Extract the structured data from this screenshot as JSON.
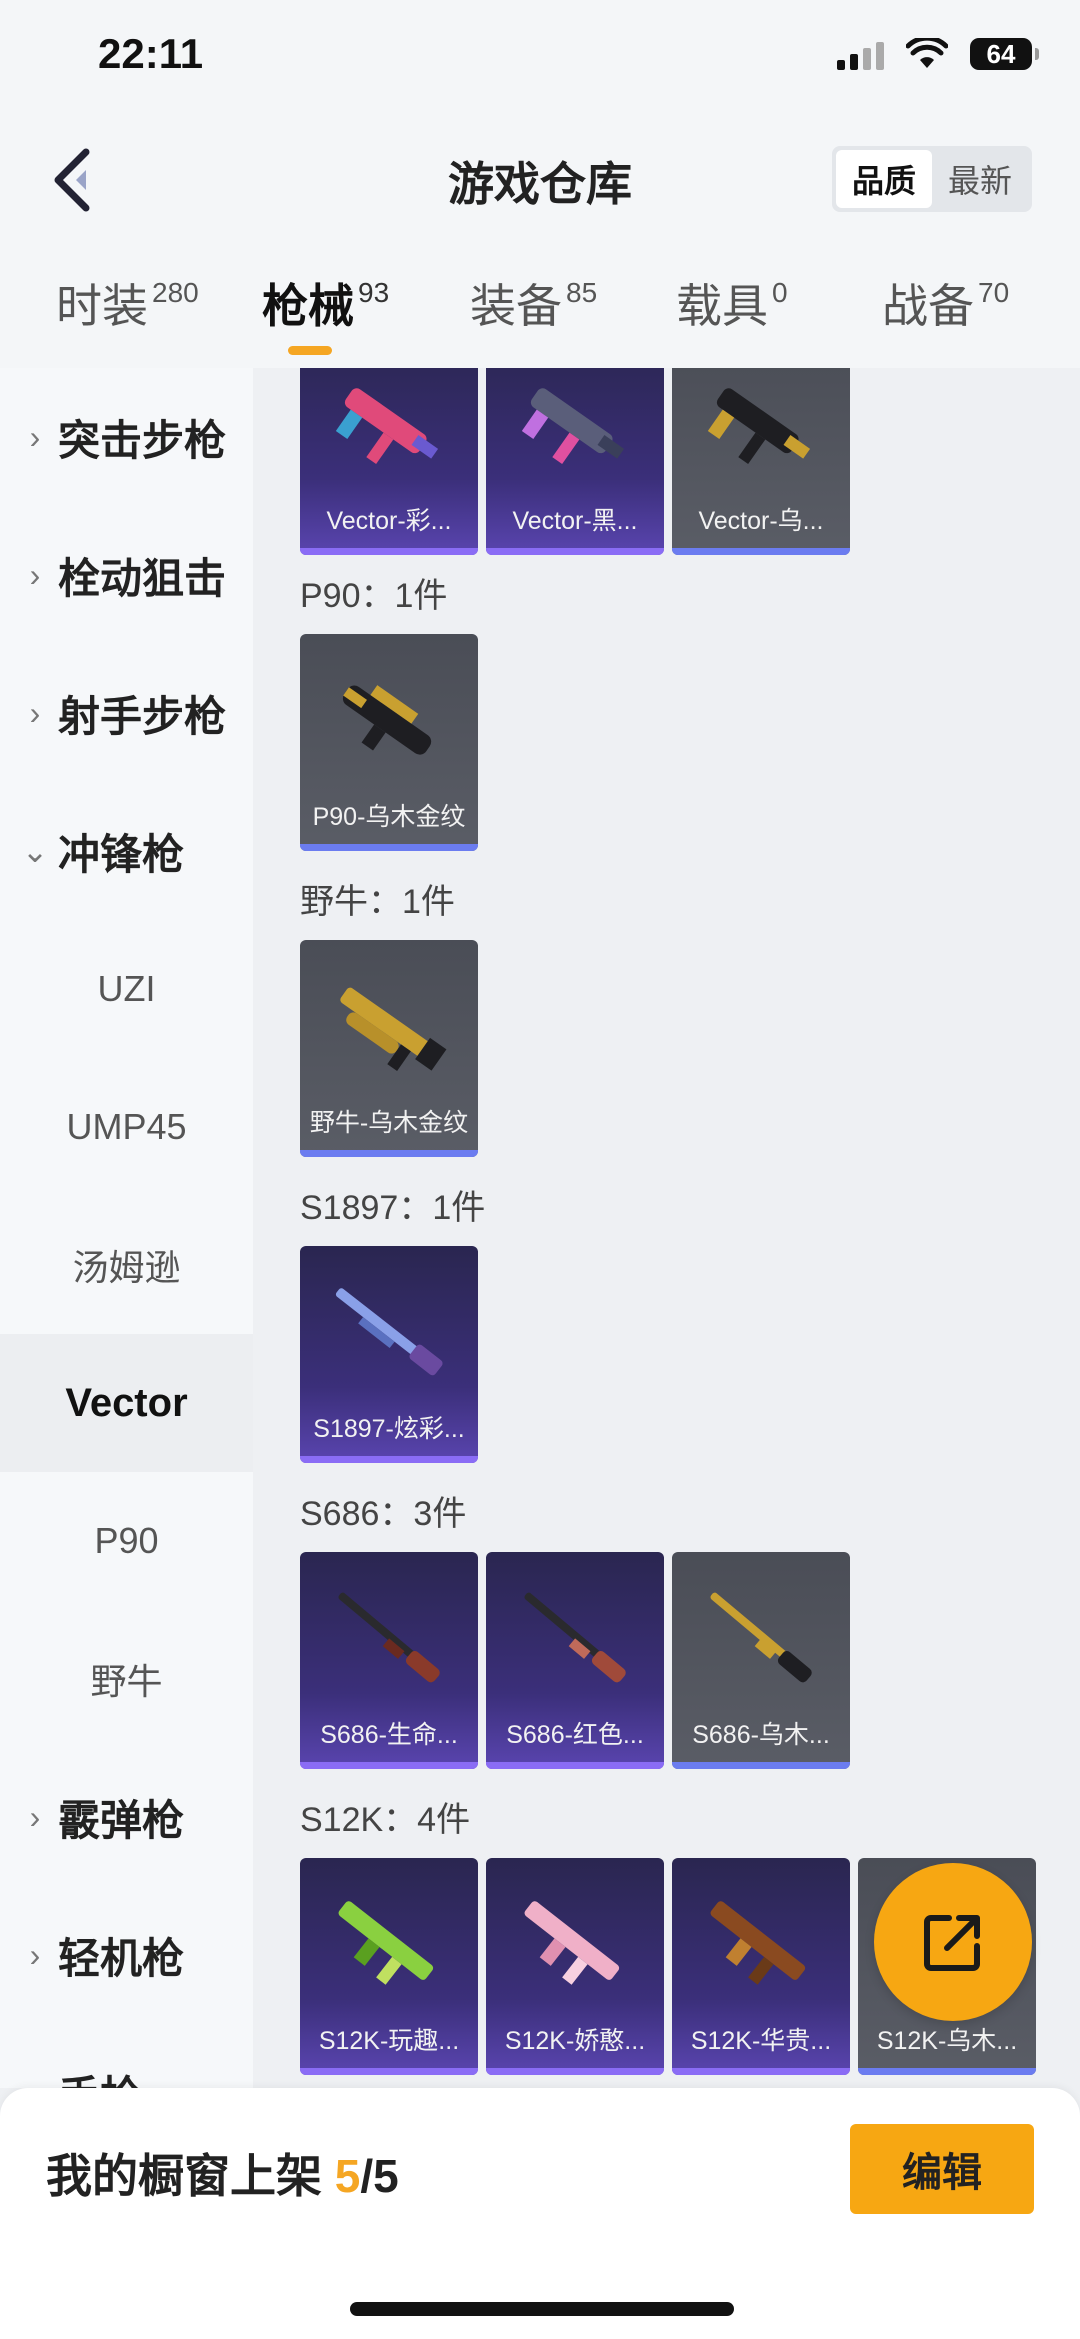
{
  "status_bar": {
    "time": "22:11",
    "battery": "64"
  },
  "header": {
    "title": "游戏仓库",
    "sort_options": [
      "品质",
      "最新"
    ],
    "active_sort": "品质"
  },
  "tabs": [
    {
      "label": "时装",
      "count": "280"
    },
    {
      "label": "枪械",
      "count": "93"
    },
    {
      "label": "装备",
      "count": "85"
    },
    {
      "label": "载具",
      "count": "0"
    },
    {
      "label": "战备",
      "count": "70"
    }
  ],
  "active_tab": "枪械",
  "sidebar": {
    "categories": [
      {
        "label": "突击步枪",
        "icon": "chevron-right-icon"
      },
      {
        "label": "栓动狙击",
        "icon": "chevron-right-icon"
      },
      {
        "label": "射手步枪",
        "icon": "chevron-right-icon"
      },
      {
        "label": "冲锋枪",
        "icon": "chevron-down-icon"
      },
      {
        "label": "霰弹枪",
        "icon": "chevron-right-icon"
      },
      {
        "label": "轻机枪",
        "icon": "chevron-right-icon"
      },
      {
        "label": "手枪",
        "icon": "chevron-right-icon"
      }
    ],
    "subitems": [
      "UZI",
      "UMP45",
      "汤姆逊",
      "Vector",
      "P90",
      "野牛"
    ],
    "selected_subitem": "Vector"
  },
  "content": {
    "sections": [
      {
        "label": "",
        "items": [
          {
            "name": "Vector-彩...",
            "rarity": "purple"
          },
          {
            "name": "Vector-黑...",
            "rarity": "purple"
          },
          {
            "name": "Vector-乌...",
            "rarity": "grey"
          }
        ]
      },
      {
        "label": "P90：1件",
        "items": [
          {
            "name": "P90-乌木金纹",
            "rarity": "grey"
          }
        ]
      },
      {
        "label": "野牛：1件",
        "items": [
          {
            "name": "野牛-乌木金纹",
            "rarity": "grey"
          }
        ]
      },
      {
        "label": "S1897：1件",
        "items": [
          {
            "name": "S1897-炫彩...",
            "rarity": "purple"
          }
        ]
      },
      {
        "label": "S686：3件",
        "items": [
          {
            "name": "S686-生命...",
            "rarity": "purple"
          },
          {
            "name": "S686-红色...",
            "rarity": "purple"
          },
          {
            "name": "S686-乌木...",
            "rarity": "grey"
          }
        ]
      },
      {
        "label": "S12K：4件",
        "items": [
          {
            "name": "S12K-玩趣...",
            "rarity": "purple"
          },
          {
            "name": "S12K-娇憨...",
            "rarity": "purple"
          },
          {
            "name": "S12K-华贵...",
            "rarity": "purple"
          },
          {
            "name": "S12K-乌木...",
            "rarity": "grey"
          }
        ]
      }
    ]
  },
  "fab": {
    "icon": "share-icon"
  },
  "bottom_bar": {
    "prefix": "我的橱窗上架 ",
    "current": "5",
    "total": "/5",
    "edit_label": "编辑"
  },
  "colors": {
    "accent": "#f5a623",
    "purple_card": "#3b2f7a",
    "grey_card": "#55585f",
    "stripe": "#6b7cf0"
  }
}
